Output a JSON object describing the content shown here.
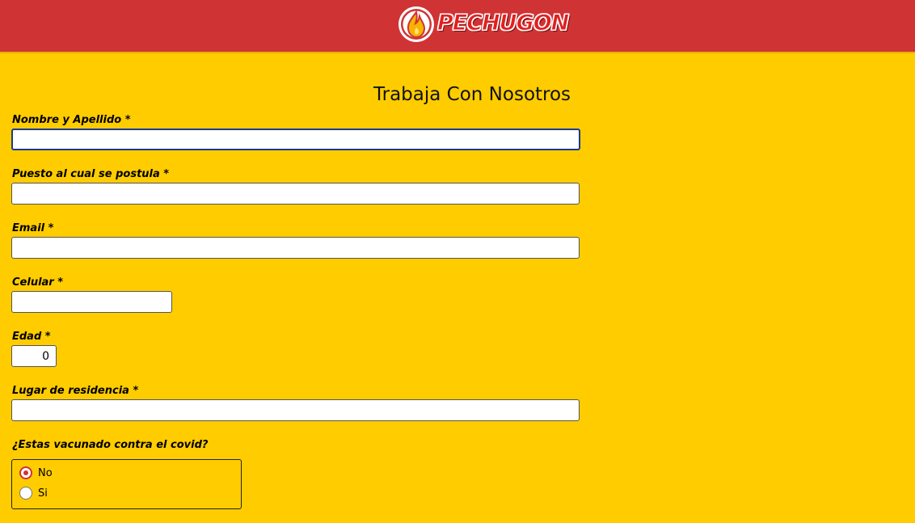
{
  "header": {
    "brand_name": "PECHUGON",
    "bg_color": "#d03334"
  },
  "form": {
    "title": "Trabaja Con Nosotros",
    "fields": {
      "nombre": {
        "label": "Nombre y Apellido *",
        "value": ""
      },
      "puesto": {
        "label": "Puesto al cual se postula *",
        "value": ""
      },
      "email": {
        "label": "Email *",
        "value": ""
      },
      "celular": {
        "label": "Celular *",
        "value": ""
      },
      "edad": {
        "label": "Edad *",
        "value": "0"
      },
      "residencia": {
        "label": "Lugar de residencia *",
        "value": ""
      }
    },
    "vacunado": {
      "question": "¿Estas vacunado contra el covid?",
      "options": [
        {
          "label": "No",
          "selected": true
        },
        {
          "label": "Si",
          "selected": false
        }
      ]
    }
  },
  "colors": {
    "background": "#ffcc00",
    "accent": "#d03334"
  }
}
